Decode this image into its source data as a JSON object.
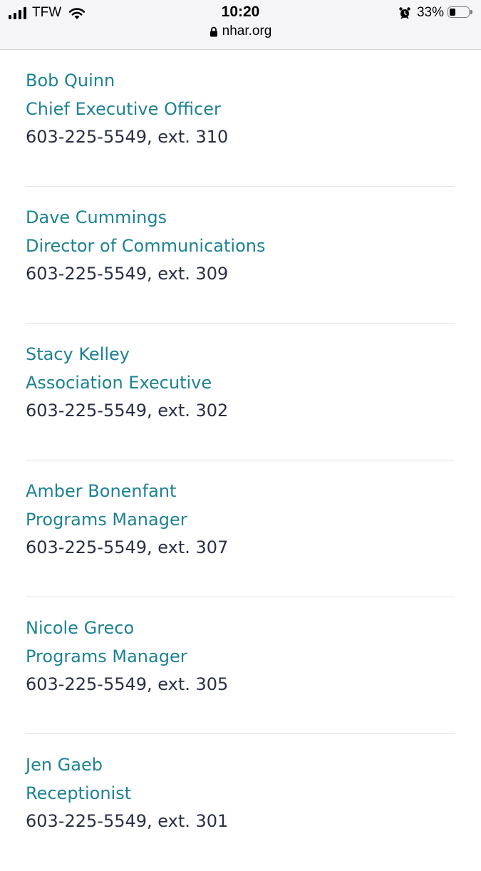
{
  "status_bar": {
    "carrier": "TFW",
    "time": "10:20",
    "url": "nhar.org",
    "battery_percent": "33%",
    "battery_level": 0.33,
    "icons": [
      "signal-icon",
      "wifi-icon",
      "lock-icon",
      "alarm-icon",
      "battery-icon"
    ]
  },
  "colors": {
    "link": "#1d8293",
    "phone_text": "#2a2f45",
    "divider": "#e2e2e2"
  },
  "staff": [
    {
      "name": "Bob Quinn",
      "title": "Chief Executive Officer",
      "phone": "603-225-5549, ext. 310"
    },
    {
      "name": "Dave Cummings",
      "title": "Director of Communications",
      "phone": "603-225-5549, ext. 309"
    },
    {
      "name": "Stacy Kelley",
      "title": "Association Executive",
      "phone": "603-225-5549, ext. 302"
    },
    {
      "name": "Amber Bonenfant",
      "title": "Programs Manager",
      "phone": "603-225-5549, ext. 307"
    },
    {
      "name": "Nicole Greco",
      "title": "Programs Manager",
      "phone": "603-225-5549, ext. 305"
    },
    {
      "name": "Jen Gaeb",
      "title": "Receptionist",
      "phone": "603-225-5549, ext. 301"
    }
  ]
}
